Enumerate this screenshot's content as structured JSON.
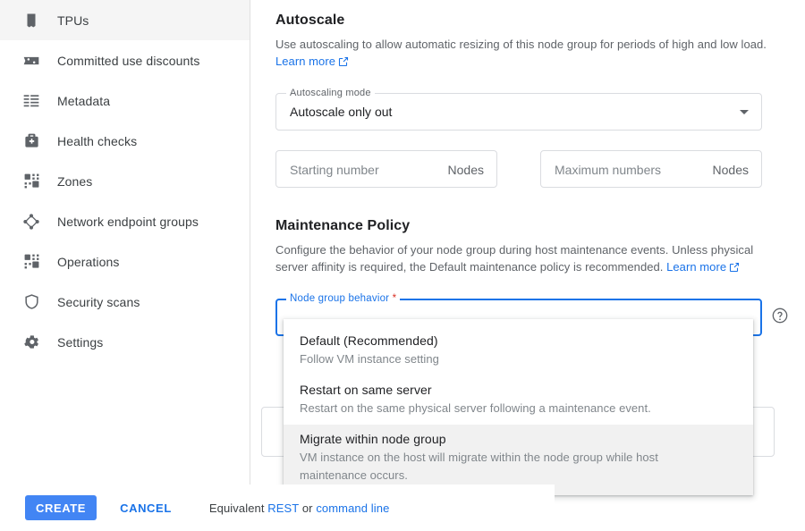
{
  "sidebar": {
    "items": [
      {
        "label": "TPUs",
        "icon": "tpu-chip-icon"
      },
      {
        "label": "Committed use discounts",
        "icon": "percent-tag-icon"
      },
      {
        "label": "Metadata",
        "icon": "list-rows-icon"
      },
      {
        "label": "Health checks",
        "icon": "medical-kit-icon"
      },
      {
        "label": "Zones",
        "icon": "grid-blocks-icon"
      },
      {
        "label": "Network endpoint groups",
        "icon": "network-nodes-icon"
      },
      {
        "label": "Operations",
        "icon": "grid-blocks-icon"
      },
      {
        "label": "Security scans",
        "icon": "shield-icon"
      },
      {
        "label": "Settings",
        "icon": "gear-icon"
      }
    ]
  },
  "autoscale": {
    "title": "Autoscale",
    "description": "Use autoscaling to allow automatic resizing of this node group for periods of high and low load.",
    "learn_more": "Learn more",
    "mode_field": {
      "label": "Autoscaling mode",
      "value": "Autoscale only out",
      "icon": "chevron-down-icon"
    },
    "starting_number": {
      "placeholder": "Starting number",
      "suffix": "Nodes",
      "value": ""
    },
    "maximum_numbers": {
      "placeholder": "Maximum numbers",
      "suffix": "Nodes",
      "value": ""
    }
  },
  "maintenance": {
    "title": "Maintenance Policy",
    "description": "Configure the behavior of your node group during host maintenance events. Unless physical server affinity is required, the Default maintenance policy is recommended.",
    "learn_more": "Learn more",
    "behavior_field": {
      "label": "Node group behavior",
      "required_marker": "*",
      "value": "",
      "help_icon": "help-circle-icon"
    },
    "options": [
      {
        "title": "Default (Recommended)",
        "subtitle": "Follow VM instance setting",
        "highlighted": false
      },
      {
        "title": "Restart on same server",
        "subtitle": "Restart on the same physical server following a maintenance event.",
        "highlighted": false
      },
      {
        "title": "Migrate within node group",
        "subtitle": "VM instance on the host will migrate within the node group while host maintenance occurs.",
        "highlighted": true
      }
    ]
  },
  "footer": {
    "create_label": "CREATE",
    "cancel_label": "CANCEL",
    "equivalent_prefix": "Equivalent ",
    "rest_label": "REST",
    "or_label": " or ",
    "command_line_label": "command line"
  },
  "colors": {
    "accent_blue": "#1a73e8",
    "button_blue": "#4285f4",
    "required_red": "#d93025",
    "text_primary": "#202124",
    "text_secondary": "#5f6368",
    "border": "#dadce0",
    "highlight_bg": "#f1f1f1"
  }
}
